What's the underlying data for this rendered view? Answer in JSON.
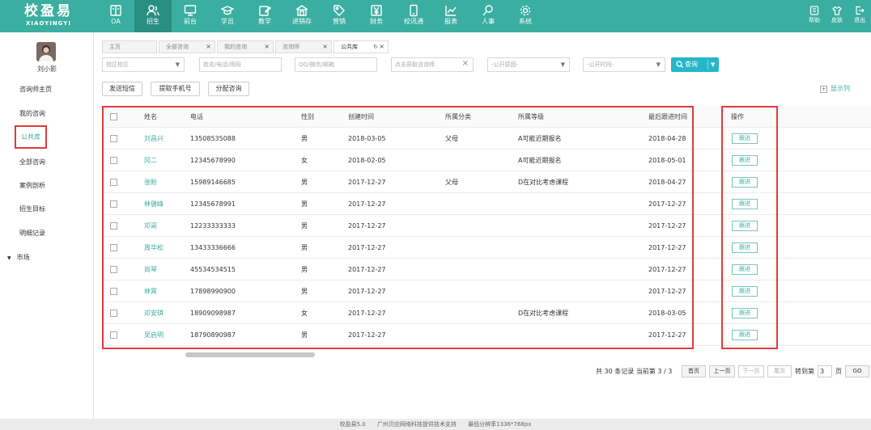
{
  "logo": {
    "main": "校盈易",
    "sub": "XIAOYINGYI"
  },
  "modules": [
    {
      "label": "OA",
      "icon": "book-icon"
    },
    {
      "label": "招生",
      "icon": "users-icon"
    },
    {
      "label": "前台",
      "icon": "monitor-icon"
    },
    {
      "label": "学员",
      "icon": "graduation-cap-icon"
    },
    {
      "label": "教学",
      "icon": "edit-icon"
    },
    {
      "label": "进销存",
      "icon": "warehouse-icon"
    },
    {
      "label": "营销",
      "icon": "tag-icon"
    },
    {
      "label": "财务",
      "icon": "yen-icon"
    },
    {
      "label": "校讯通",
      "icon": "phone-icon"
    },
    {
      "label": "报表",
      "icon": "chart-icon"
    },
    {
      "label": "人事",
      "icon": "person-search-icon"
    },
    {
      "label": "系统",
      "icon": "gear-icon"
    }
  ],
  "right_modules": [
    {
      "label": "帮助",
      "icon": "help-icon"
    },
    {
      "label": "皮肤",
      "icon": "shirt-icon"
    },
    {
      "label": "退出",
      "icon": "logout-icon"
    }
  ],
  "user": {
    "name": "刘小影"
  },
  "sidebar": {
    "items": [
      "咨询师主页",
      "我的咨询",
      "公共库",
      "全部咨询",
      "案例剖析",
      "招生目标",
      "明细记录"
    ],
    "market": "市场"
  },
  "tabs": [
    "主页",
    "全部咨询",
    "我的咨询",
    "咨询师",
    "公共库"
  ],
  "filters": {
    "campus": "校区校区",
    "name_phone": "姓名/电话/简码",
    "qq": "QQ/微信/邮箱",
    "source": "点击获取咨询师",
    "reason": "-公开原因-",
    "time": "-公开时间-",
    "search_label": "查询"
  },
  "actions": {
    "sms": "发送短信",
    "phone": "提取手机号",
    "assign": "分配咨询"
  },
  "show_columns": "显示列",
  "table": {
    "headers": [
      "姓名",
      "电话",
      "性别",
      "创建时间",
      "所属分类",
      "所属等级",
      "最后跟进时间",
      "操作"
    ],
    "rows": [
      {
        "name": "刘昌兴",
        "phone": "13508535088",
        "gender": "男",
        "created": "2018-03-05",
        "category": "父母",
        "level": "A可能近期报名",
        "last": "2018-04-28"
      },
      {
        "name": "冈二",
        "phone": "12345678990",
        "gender": "女",
        "created": "2018-02-05",
        "category": "",
        "level": "A可能近期报名",
        "last": "2018-05-01"
      },
      {
        "name": "张盼",
        "phone": "15989146685",
        "gender": "男",
        "created": "2017-12-27",
        "category": "父母",
        "level": "D在对比考虑课程",
        "last": "2018-04-27"
      },
      {
        "name": "林健峰",
        "phone": "12345678991",
        "gender": "男",
        "created": "2017-12-27",
        "category": "",
        "level": "",
        "last": "2017-12-27"
      },
      {
        "name": "邓哥",
        "phone": "12233333333",
        "gender": "男",
        "created": "2017-12-27",
        "category": "",
        "level": "",
        "last": "2017-12-27"
      },
      {
        "name": "周华松",
        "phone": "13433336666",
        "gender": "男",
        "created": "2017-12-27",
        "category": "",
        "level": "",
        "last": "2017-12-27"
      },
      {
        "name": "尚琴",
        "phone": "45534534515",
        "gender": "男",
        "created": "2017-12-27",
        "category": "",
        "level": "",
        "last": "2017-12-27"
      },
      {
        "name": "林霄",
        "phone": "17898990900",
        "gender": "男",
        "created": "2017-12-27",
        "category": "",
        "level": "",
        "last": "2017-12-27"
      },
      {
        "name": "邓安琪",
        "phone": "18909098987",
        "gender": "女",
        "created": "2017-12-27",
        "category": "",
        "level": "D在对比考虑课程",
        "last": "2018-03-05"
      },
      {
        "name": "吴启明",
        "phone": "18790890987",
        "gender": "男",
        "created": "2017-12-27",
        "category": "",
        "level": "",
        "last": "2017-12-27"
      }
    ],
    "follow_label": "跟进"
  },
  "pager": {
    "summary": "共 30 条记录 当前第 3 / 3",
    "first": "首页",
    "prev": "上一页",
    "next": "下一页",
    "last": "尾页",
    "goto_prefix": "转到第",
    "page_value": "3",
    "goto_suffix": "页",
    "go": "GO"
  },
  "footer": {
    "version": "校盈易5.0",
    "company": "广州贝应网络科技提供技术支持",
    "resolution": "最低分辨率1336*768px"
  },
  "colors": {
    "brand": "#3aaea0",
    "active_module": "#2a8e82",
    "highlight": "#e23a3a",
    "search": "#25b7c9"
  }
}
